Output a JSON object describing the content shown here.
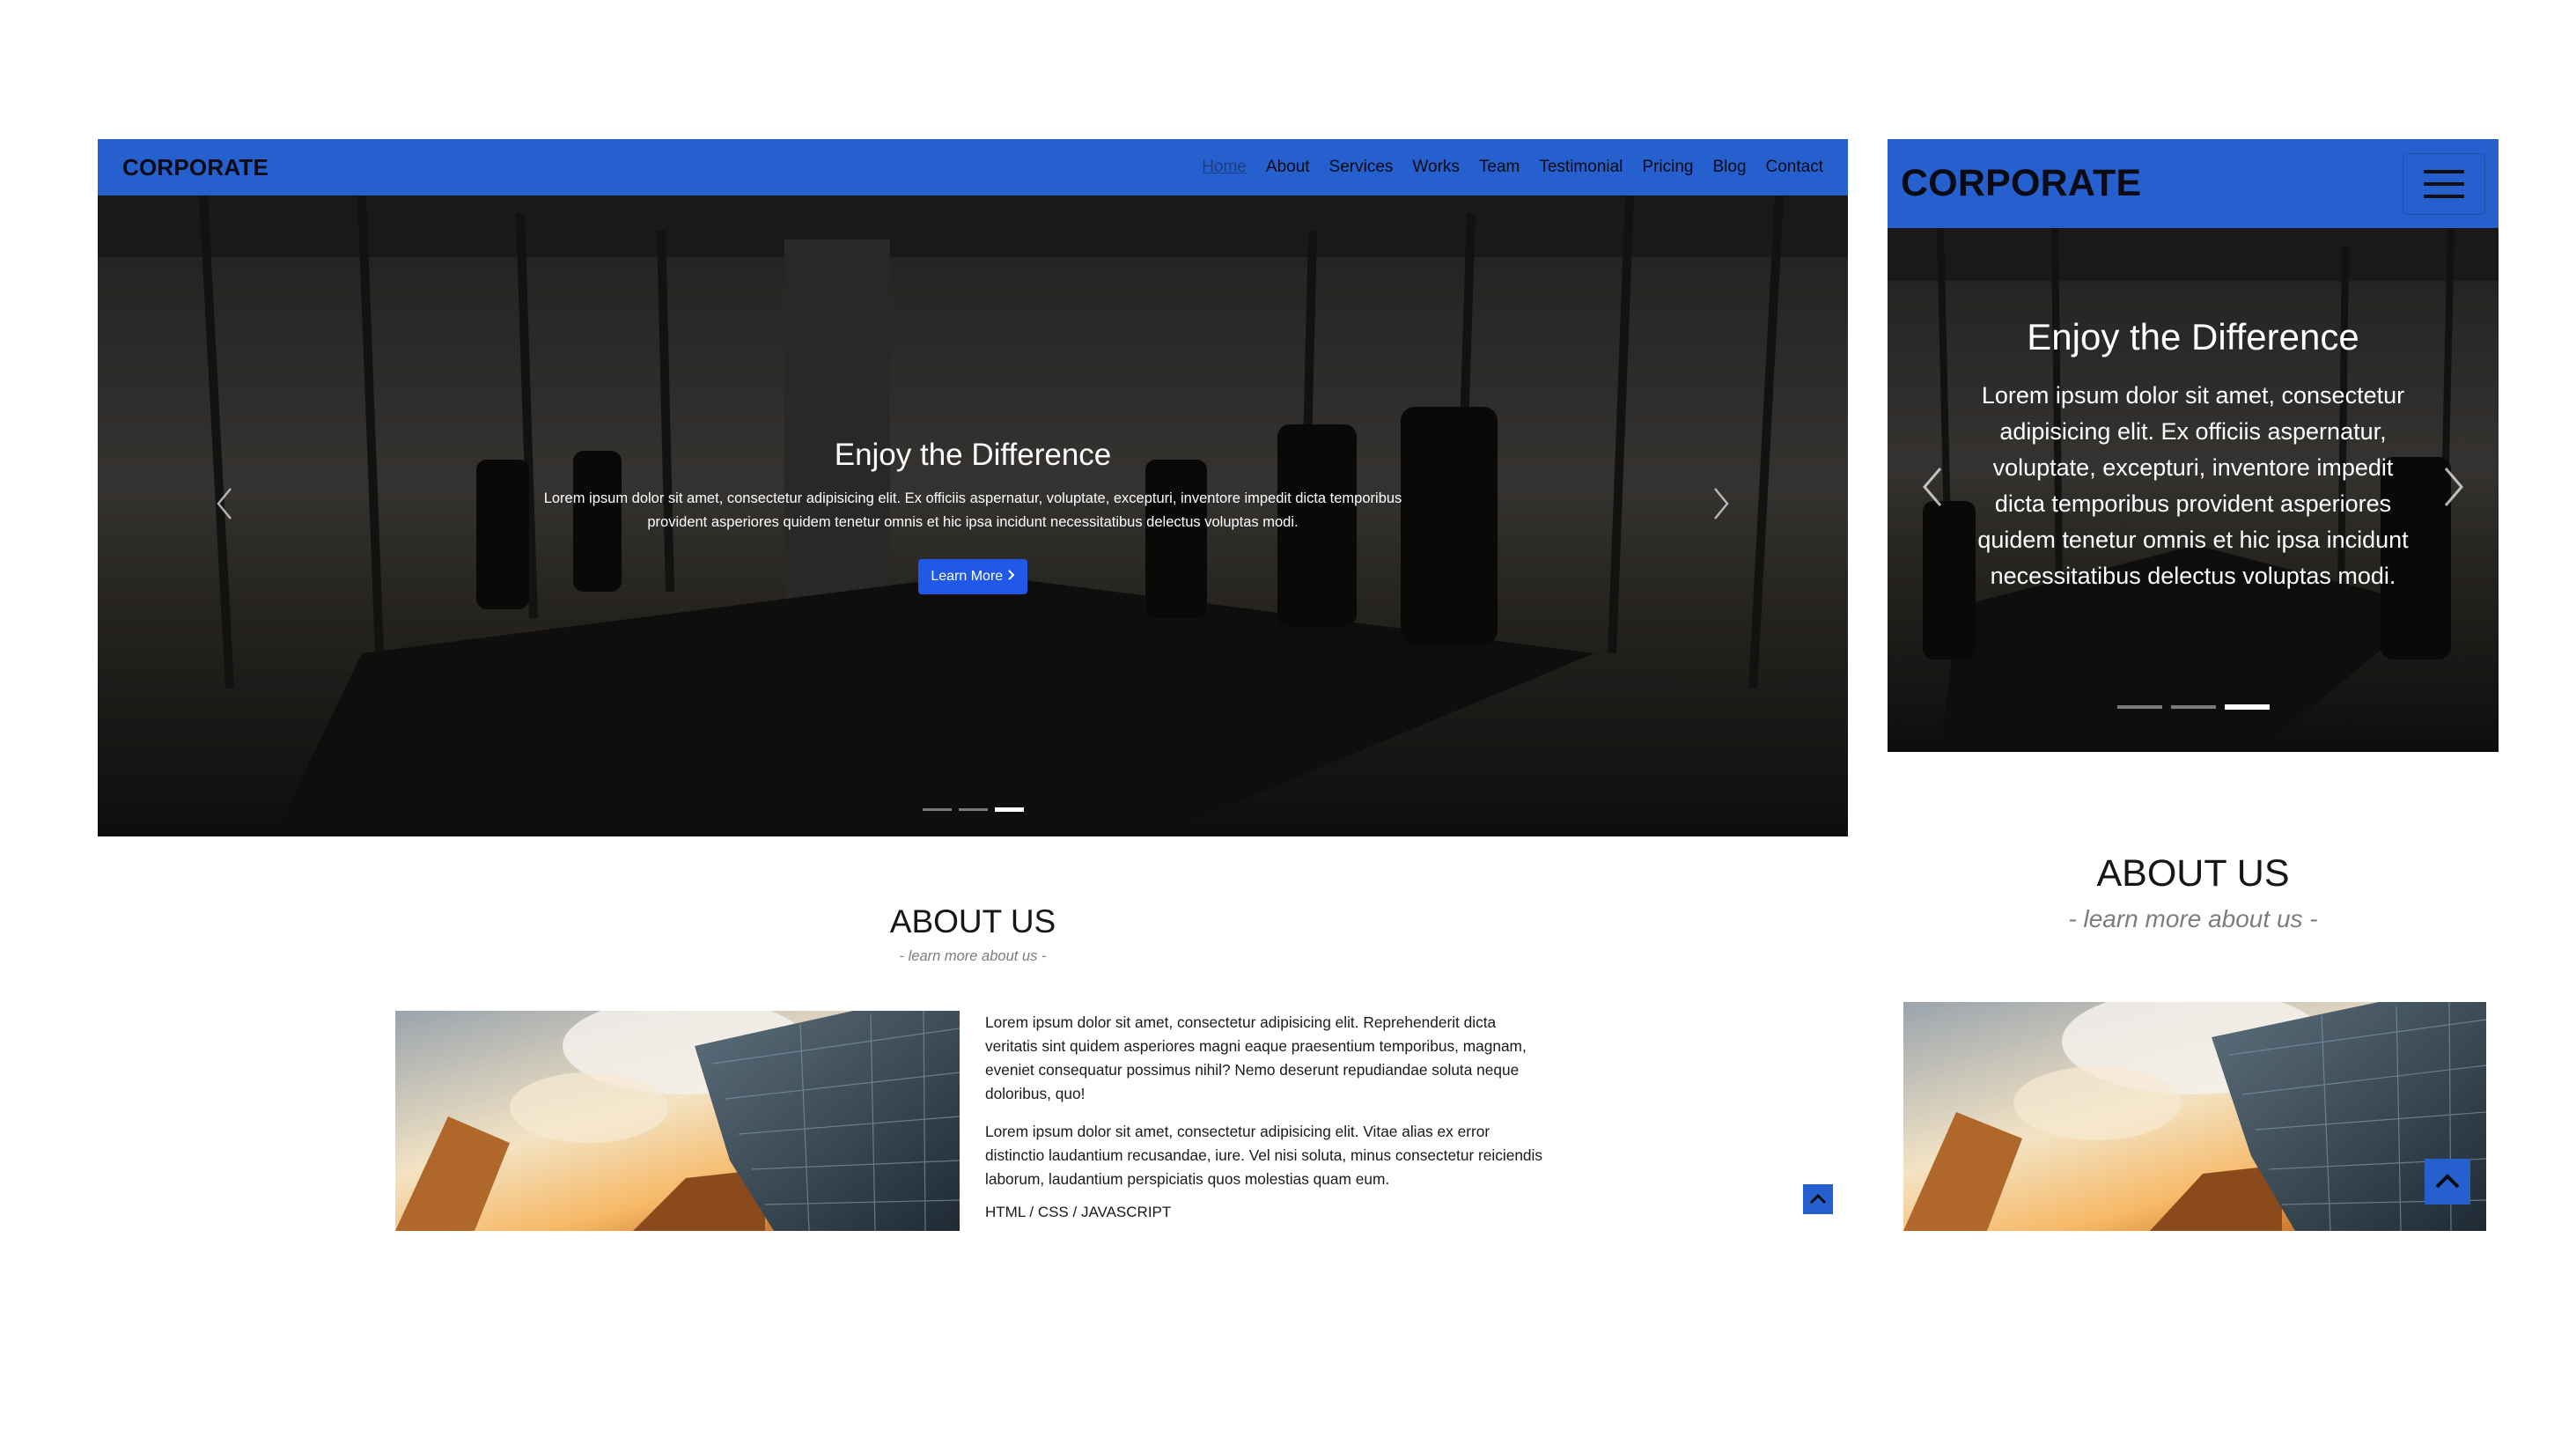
{
  "brand": "CORPORATE",
  "nav": {
    "items": [
      "Home",
      "About",
      "Services",
      "Works",
      "Team",
      "Testimonial",
      "Pricing",
      "Blog",
      "Contact"
    ],
    "active": "Home"
  },
  "hero": {
    "title": "Enjoy the Difference",
    "text": "Lorem ipsum dolor sit amet, consectetur adipisicing elit. Ex officiis aspernatur, voluptate, excepturi, inventore impedit dicta temporibus provident asperiores quidem tenetur omnis et hic ipsa incidunt necessitatibus delectus voluptas modi.",
    "button": "Learn More",
    "slide_count": 3,
    "active_slide": 3
  },
  "about": {
    "title": "ABOUT US",
    "subtitle": "- learn more about us -",
    "para1": "Lorem ipsum dolor sit amet, consectetur adipisicing elit. Reprehenderit dicta veritatis sint quidem asperiores magni eaque praesentium temporibus, magnam, eveniet consequatur possimus nihil? Nemo deserunt repudiandae soluta neque doloribus, quo!",
    "para2": "Lorem ipsum dolor sit amet, consectetur adipisicing elit. Vitae alias ex error distinctio laudantium recusandae, iure. Vel nisi soluta, minus consectetur reiciendis laborum, laudantium perspiciatis quos molestias quam eum.",
    "tech": "HTML / CSS / JAVASCRIPT"
  },
  "icons": {
    "prev": "chevron-left-icon",
    "next": "chevron-right-icon",
    "learn_more": "chevron-right-icon",
    "menu": "hamburger-icon",
    "back_to_top": "chevron-up-icon"
  },
  "colors": {
    "navbar": "#2660cf",
    "button": "#2058e8",
    "back_to_top": "#2660cf"
  }
}
